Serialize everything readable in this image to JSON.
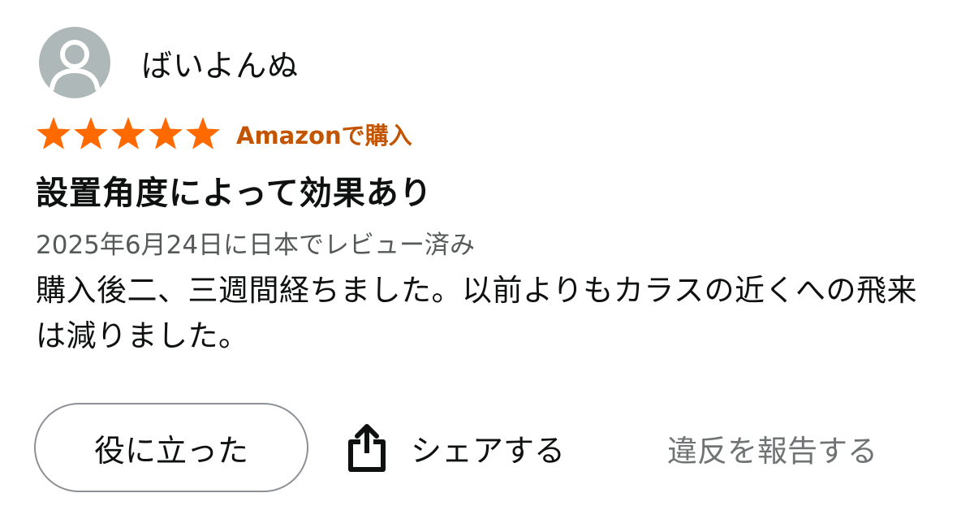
{
  "reviewer": {
    "name": "ばいよんぬ",
    "avatar_icon": "person-silhouette-icon",
    "avatar_color": "#aeb8b8"
  },
  "rating": {
    "stars": 5,
    "max": 5,
    "star_color": "#ff6a00",
    "verified_label": "Amazonで購入",
    "verified_color": "#c45500"
  },
  "review": {
    "title": "設置角度によって効果あり",
    "date_text": "2025年6月24日に日本でレビュー済み",
    "body": "購入後二、三週間経ちました。以前よりもカラスの近くへの飛来は減りました。"
  },
  "actions": {
    "helpful_label": "役に立った",
    "share_icon": "share-icon",
    "share_label": "シェアする",
    "report_label": "違反を報告する"
  }
}
